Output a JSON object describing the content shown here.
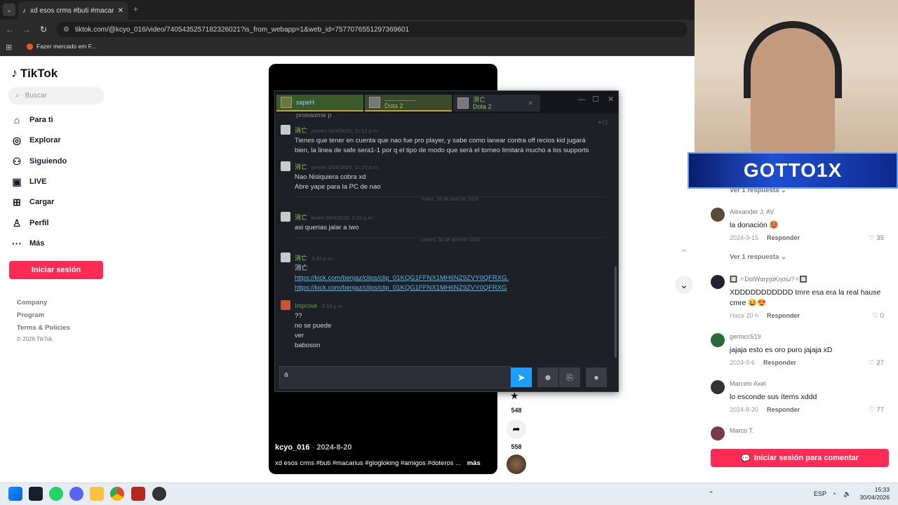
{
  "browser": {
    "tab_title": "xd esos crms #buti #macarius #",
    "url": "tiktok.com/@kcyo_016/video/7405435257182326021?is_from_webapp=1&web_id=7577076551297369601",
    "bookmark": "Fazer mercado em F..."
  },
  "tiktok": {
    "logo": "TikTok",
    "search_placeholder": "Buscar",
    "nav": [
      {
        "label": "Para ti",
        "icon": "home-icon"
      },
      {
        "label": "Explorar",
        "icon": "compass-icon"
      },
      {
        "label": "Siguiendo",
        "icon": "following-icon"
      },
      {
        "label": "LIVE",
        "icon": "live-icon"
      },
      {
        "label": "Cargar",
        "icon": "upload-icon"
      },
      {
        "label": "Perfil",
        "icon": "profile-icon"
      },
      {
        "label": "Más",
        "icon": "more-icon"
      }
    ],
    "login_button": "Iniciar sesión",
    "footer": [
      "Company",
      "Program",
      "Terms & Policies",
      "© 2026 TikTok"
    ],
    "video": {
      "author": "kcyo_016",
      "date": "2024-8-20",
      "description": "xd esos crms #buti #macarius #glogloking #amigos #doteros ...",
      "more": "más"
    },
    "actions": {
      "saves": "548",
      "shares": "558"
    }
  },
  "steam_chat": {
    "tabs": [
      {
        "name": "sapeH",
        "game": ""
      },
      {
        "name": "..................",
        "game": "Dota 2"
      },
      {
        "name": "消亡",
        "game": "Dota 2"
      }
    ],
    "partial_line": "probadme p",
    "messages": [
      {
        "user": "消亡",
        "time": "jueves 16/4/2026, 11:12 p.m.",
        "lines": [
          "Tienes que tener en cuenta que nao fue pro player, y sabe como lanear contra off recios kid jugará",
          "bien, la linea de safe sera1-1 por q el tipo de modo que será el torneo limitará mucho a los supports"
        ]
      },
      {
        "user": "消亡",
        "time": "jueves 16/4/2026, 11:25 p.m.",
        "lines": [
          "Nao Nisiquiera cobra xd",
          "Abre yape para la PC de nao"
        ]
      },
      {
        "user": "消亡",
        "time": "lunes 20/4/2026, 2:23 p.m.",
        "lines": [
          "asi querias jalar a iwo"
        ]
      },
      {
        "user": "消亡",
        "time": "3:33 p.m.",
        "lines": [
          "消亡"
        ],
        "links": [
          "https://kick.com/benjaz/clips/clip_01KQG1FFNX1MH6NZ9ZVY0QFRXG.",
          "https://kick.com/benjaz/clips/clip_01KQG1FFNX1MH6NZ9ZVY0QFRXG"
        ]
      },
      {
        "user": "Improve",
        "time": "3:33 p.m.",
        "lines": [
          "??",
          "no se puede",
          "ver",
          "baboson"
        ]
      }
    ],
    "date_separators": [
      "lunes, 20 de abril de 2026",
      "jueves, 30 de abril de 2026"
    ],
    "composer_value": "a"
  },
  "stream": {
    "banner": "GOTTO1X"
  },
  "comments": [
    {
      "type": "replies",
      "label": "Ver 1 respuesta"
    },
    {
      "user": "Alexander J. AV",
      "text": "la donación 🥵",
      "date": "2024-9-15",
      "likes": "35"
    },
    {
      "type": "replies",
      "label": "Ver 1 respuesta"
    },
    {
      "user": "🔲 ✧DolWαηηαΚησω?✧🔲",
      "text": "XDDDDDDDDDDD tmre esa era la real hause cmre 😆😍",
      "date": "Hace 20 h",
      "likes": "0"
    },
    {
      "user": "germcc519",
      "text": "jajaja esto es oro puro jajaja xD",
      "date": "2024-9-6",
      "likes": "27"
    },
    {
      "user": "Marcelo Axel",
      "text": "lo esconde sus ítems xddd",
      "date": "2024-8-20",
      "likes": "77"
    },
    {
      "user": "Marco T.",
      "text": "",
      "date": "",
      "likes": ""
    }
  ],
  "reply_label": "Responder",
  "comment_button": "Iniciar sesión para comentar",
  "taskbar": {
    "lang": "ESP",
    "time": "15:33",
    "date": "30/04/2026"
  },
  "colors": {
    "brand": "#fe2c55",
    "steam_blue": "#1a9fff",
    "chat_name": "#8fbf5a"
  }
}
